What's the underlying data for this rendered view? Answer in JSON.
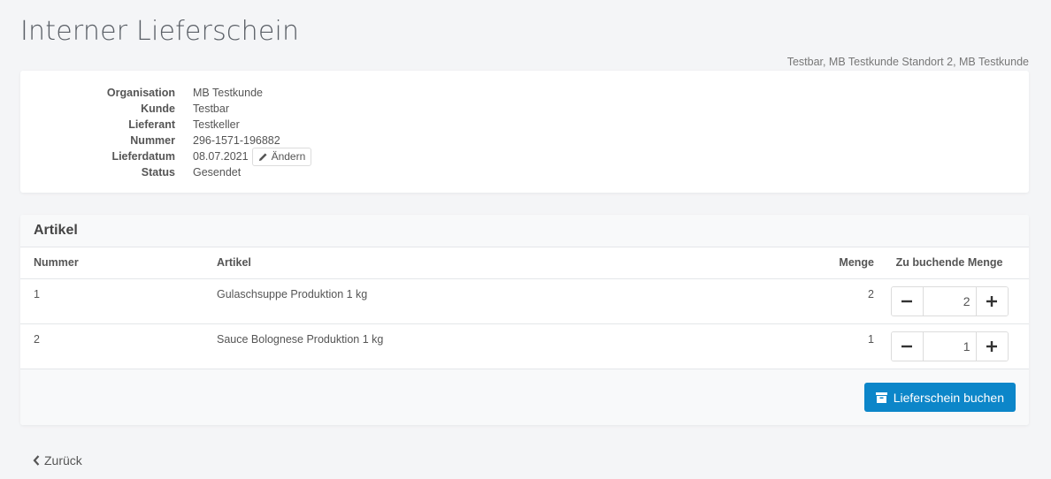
{
  "page": {
    "title": "Interner Lieferschein",
    "context": "Testbar, MB Testkunde Standort 2, MB Testkunde"
  },
  "info": {
    "rows": [
      {
        "label": "Organisation",
        "value": "MB Testkunde"
      },
      {
        "label": "Kunde",
        "value": "Testbar"
      },
      {
        "label": "Lieferant",
        "value": "Testkeller"
      },
      {
        "label": "Nummer",
        "value": "296-1571-196882"
      },
      {
        "label": "Lieferdatum",
        "value": "08.07.2021"
      },
      {
        "label": "Status",
        "value": "Gesendet"
      }
    ],
    "change_label": "Ändern"
  },
  "articles": {
    "title": "Artikel",
    "columns": {
      "number": "Nummer",
      "article": "Artikel",
      "quantity": "Menge",
      "to_book": "Zu buchende Menge"
    },
    "rows": [
      {
        "number": "1",
        "article": "Gulaschsuppe Produktion 1 kg",
        "quantity": "2",
        "to_book": "2"
      },
      {
        "number": "2",
        "article": "Sauce Bolognese Produktion 1 kg",
        "quantity": "1",
        "to_book": "1"
      }
    ],
    "book_label": "Lieferschein buchen"
  },
  "nav": {
    "back_label": "Zurück"
  },
  "icons": {
    "change": "pencil-icon",
    "book": "box-icon",
    "back": "chevron-left-icon",
    "decrement": "minus-icon",
    "increment": "plus-icon"
  },
  "colors": {
    "primary": "#0c86c9",
    "background": "#f4f5f7"
  }
}
